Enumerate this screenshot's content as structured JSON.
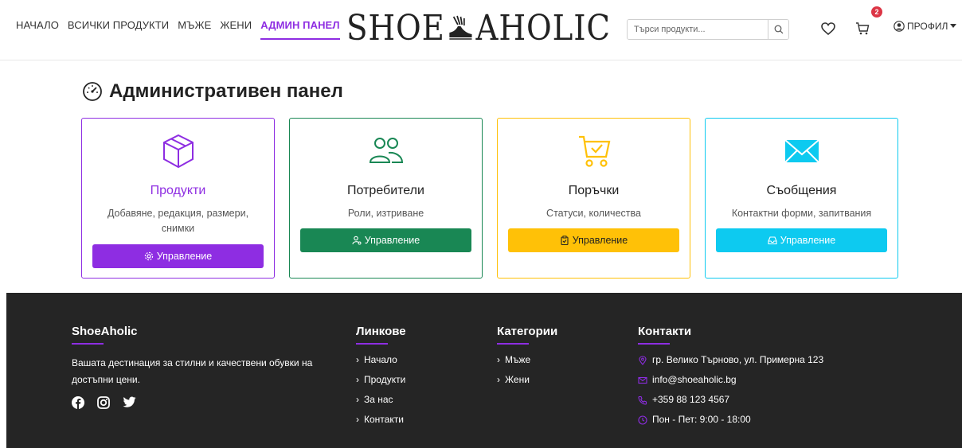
{
  "nav": {
    "items": [
      "НАЧАЛО",
      "ВСИЧКИ ПРОДУКТИ",
      "МЪЖЕ",
      "ЖЕНИ",
      "АДМИН ПАНЕЛ"
    ],
    "active_index": 4
  },
  "logo": {
    "left": "SHOE",
    "right": "AHOLIC"
  },
  "search": {
    "placeholder": "Търси продукти..."
  },
  "cart": {
    "count": "2"
  },
  "profile": {
    "label": "ПРОФИЛ"
  },
  "page": {
    "title": "Административен панел"
  },
  "cards": [
    {
      "title": "Продукти",
      "desc": "Добавяне, редакция, размери, снимки",
      "button": "Управление",
      "color": "#8e2de2",
      "icon": "box-icon"
    },
    {
      "title": "Потребители",
      "desc": "Роли, изтриване",
      "button": "Управление",
      "color": "#198754",
      "icon": "users-icon"
    },
    {
      "title": "Поръчки",
      "desc": "Статуси, количества",
      "button": "Управление",
      "color": "#ffc107",
      "icon": "cart-icon"
    },
    {
      "title": "Съобщения",
      "desc": "Контактни форми, запитвания",
      "button": "Управление",
      "color": "#0dcaf0",
      "icon": "envelope-icon"
    }
  ],
  "footer": {
    "brand": {
      "title": "ShoeAholic",
      "text": "Вашата дестинация за стилни и качествени обувки на достъпни цени."
    },
    "links": {
      "title": "Линкове",
      "items": [
        "Начало",
        "Продукти",
        "За нас",
        "Контакти"
      ]
    },
    "categories": {
      "title": "Категории",
      "items": [
        "Мъже",
        "Жени"
      ]
    },
    "contacts": {
      "title": "Контакти",
      "address": "гр. Велико Търново, ул. Примерна 123",
      "email": "info@shoeaholic.bg",
      "phone": "+359 88 123 4567",
      "hours": "Пон - Пет: 9:00 - 18:00"
    }
  },
  "colors": {
    "accent": "#8e2de2",
    "footer_bg": "#252525"
  }
}
